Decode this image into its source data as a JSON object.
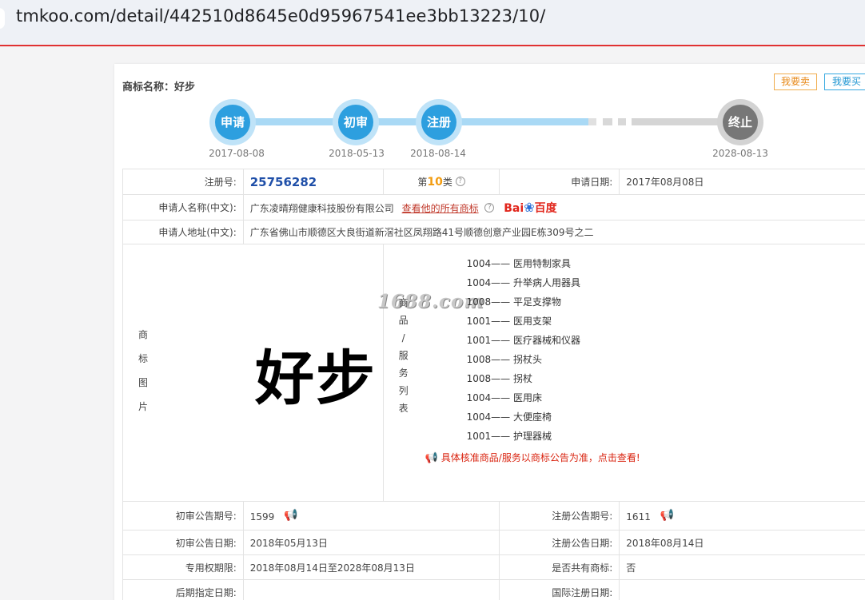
{
  "browser": {
    "url": "tmkoo.com/detail/442510d8645e0d95967541ee3bb13223/10/"
  },
  "header": {
    "name_label": "商标名称：好步",
    "sell_label": "我要卖",
    "buy_label": "我要买"
  },
  "timeline": {
    "steps": [
      {
        "label": "申请",
        "date": "2017-08-08"
      },
      {
        "label": "初审",
        "date": "2018-05-13"
      },
      {
        "label": "注册",
        "date": "2018-08-14"
      },
      {
        "label": "终止",
        "date": "2028-08-13"
      }
    ]
  },
  "info": {
    "reg_no_label": "注册号:",
    "reg_no": "25756282",
    "class_prefix": "第",
    "class_num": "10",
    "class_suffix": "类",
    "help_glyph": "?",
    "apply_date_label": "申请日期:",
    "apply_date": "2017年08月08日",
    "applicant_label": "申请人名称(中文):",
    "applicant": "广东凌晴翔健康科技股份有限公司",
    "all_marks_link": "查看他的所有商标",
    "baidu_bai": "Bai",
    "baidu_du": "百度",
    "address_label": "申请人地址(中文):",
    "address": "广东省佛山市顺德区大良街道新滘社区凤翔路41号顺德创意产业园E栋309号之二"
  },
  "image_section": {
    "label_chars": [
      "商",
      "标",
      "图",
      "片"
    ],
    "trademark_text": "好步",
    "watermark": "1688.com"
  },
  "goods_section": {
    "label_chars": [
      "商",
      "品",
      "/",
      "服",
      "务",
      "列",
      "表"
    ],
    "items": [
      {
        "code": "1004",
        "name": "医用特制家具"
      },
      {
        "code": "1004",
        "name": "升举病人用器具"
      },
      {
        "code": "1008",
        "name": "平足支撑物"
      },
      {
        "code": "1001",
        "name": "医用支架"
      },
      {
        "code": "1001",
        "name": "医疗器械和仪器"
      },
      {
        "code": "1008",
        "name": "拐杖头"
      },
      {
        "code": "1008",
        "name": "拐杖"
      },
      {
        "code": "1004",
        "name": "医用床"
      },
      {
        "code": "1004",
        "name": "大便座椅"
      },
      {
        "code": "1001",
        "name": "护理器械"
      }
    ],
    "dash": "——",
    "notice": "具体核准商品/服务以商标公告为准，点击查看!"
  },
  "publication": {
    "prelim_no_label": "初审公告期号:",
    "prelim_no": "1599",
    "reg_pub_no_label": "注册公告期号:",
    "reg_pub_no": "1611",
    "prelim_date_label": "初审公告日期:",
    "prelim_date": "2018年05月13日",
    "reg_pub_date_label": "注册公告日期:",
    "reg_pub_date": "2018年08月14日",
    "exclusive_label": "专用权期限:",
    "exclusive": "2018年08月14日至2028年08月13日",
    "shared_label": "是否共有商标:",
    "shared": "否",
    "later_label": "后期指定日期:",
    "later": "",
    "intl_label": "国际注册日期:",
    "intl": ""
  }
}
